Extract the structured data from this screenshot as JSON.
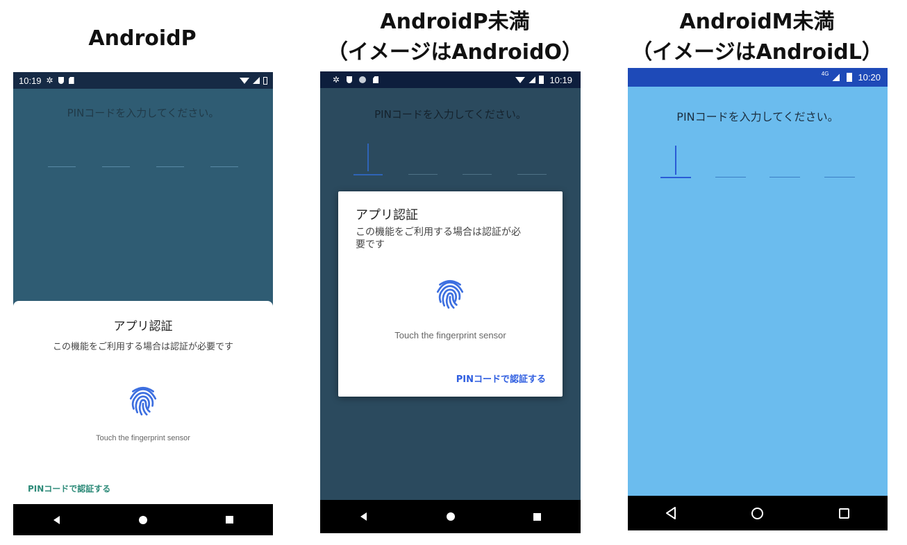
{
  "headings": {
    "p": "AndroidP",
    "o_line1": "AndroidP未満",
    "o_line2": "（イメージはAndroidO）",
    "l_line1": "AndroidM未満",
    "l_line2": "（イメージはAndroidL）"
  },
  "phone_p": {
    "time": "10:19",
    "prompt": "PINコードを入力してください。",
    "sheet_title": "アプリ認証",
    "sheet_subtitle": "この機能をご利用する場合は認証が必要です",
    "sensor_text": "Touch the fingerprint sensor",
    "pin_link": "PINコードで認証する"
  },
  "phone_o": {
    "time": "10:19",
    "prompt": "PINコードを入力してください。",
    "dialog_title": "アプリ認証",
    "dialog_subtitle_line1": "この機能をご利用する場合は認証が必",
    "dialog_subtitle_line2": "要です",
    "sensor_text": "Touch the fingerprint sensor",
    "pin_link": "PINコードで認証する"
  },
  "phone_l": {
    "time": "10:20",
    "network": "4G",
    "prompt": "PINコードを入力してください。"
  },
  "colors": {
    "p_bg": "#2f5c73",
    "o_bg": "#2b4a5e",
    "l_bg": "#6bbcee",
    "fingerprint": "#3d6fe0",
    "p_link": "#2e8b79",
    "o_link": "#2f5ee0"
  }
}
